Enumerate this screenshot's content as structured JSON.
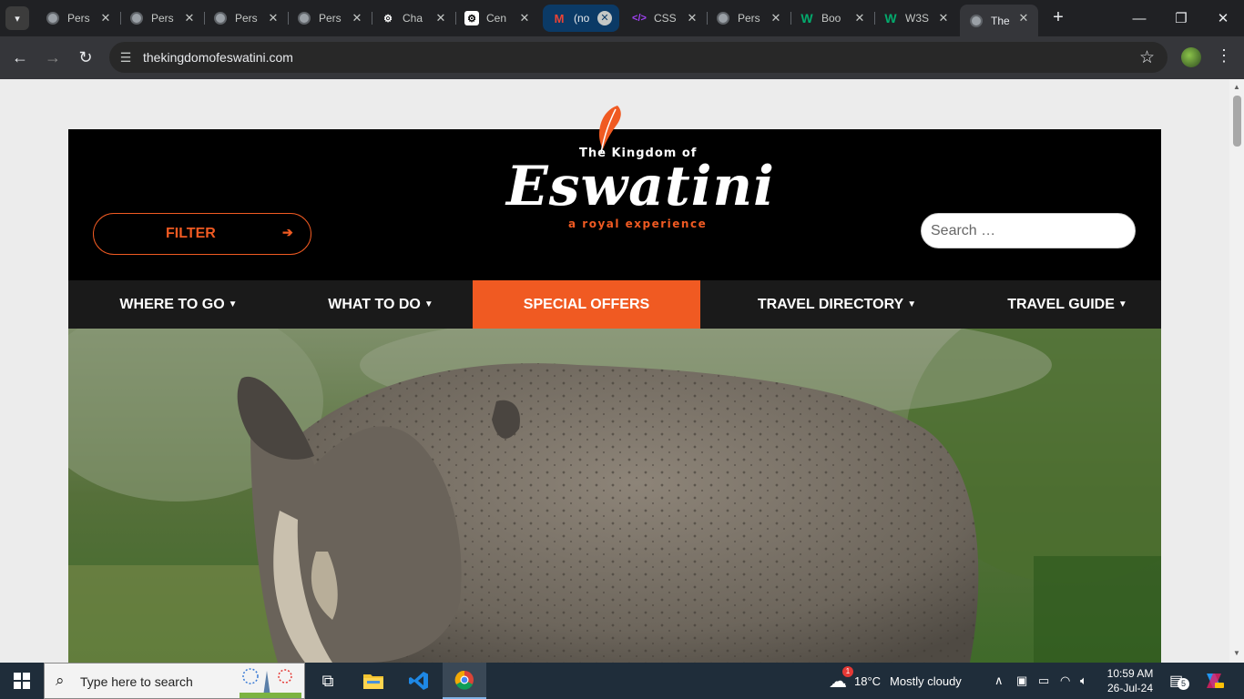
{
  "browser": {
    "tabs": [
      {
        "title": "Pers",
        "icon": "globe-icon"
      },
      {
        "title": "Pers",
        "icon": "globe-icon"
      },
      {
        "title": "Pers",
        "icon": "globe-icon"
      },
      {
        "title": "Pers",
        "icon": "globe-icon"
      },
      {
        "title": "Cha",
        "icon": "chatgpt-icon"
      },
      {
        "title": "Cen",
        "icon": "chatgpt-icon"
      },
      {
        "title": "(no",
        "icon": "gmail-icon"
      },
      {
        "title": "CSS",
        "icon": "code-icon"
      },
      {
        "title": "Pers",
        "icon": "globe-icon"
      },
      {
        "title": "Boo",
        "icon": "w-icon"
      },
      {
        "title": "W3S",
        "icon": "w-icon"
      },
      {
        "title": "The",
        "icon": "globe-icon"
      }
    ],
    "url": "thekingdomofeswatini.com"
  },
  "site": {
    "logo_top": "The Kingdom of",
    "logo_main": "Eswatini",
    "logo_sub": "a royal experience",
    "filter_label": "FILTER",
    "search_placeholder": "Search …",
    "nav": [
      {
        "label": "WHERE TO GO",
        "dropdown": true
      },
      {
        "label": "WHAT TO DO",
        "dropdown": true
      },
      {
        "label": "SPECIAL OFFERS",
        "dropdown": false
      },
      {
        "label": "TRAVEL DIRECTORY",
        "dropdown": true
      },
      {
        "label": "TRAVEL GUIDE",
        "dropdown": true
      }
    ],
    "colors": {
      "accent": "#f05a22",
      "header_bg": "#000000",
      "nav_bg": "#1a1a1a"
    }
  },
  "taskbar": {
    "search_text": "Type here to search",
    "weather_temp": "18°C",
    "weather_desc": "Mostly cloudy",
    "weather_badge": "1",
    "time": "10:59 AM",
    "date": "26-Jul-24",
    "notification_count": "5"
  }
}
